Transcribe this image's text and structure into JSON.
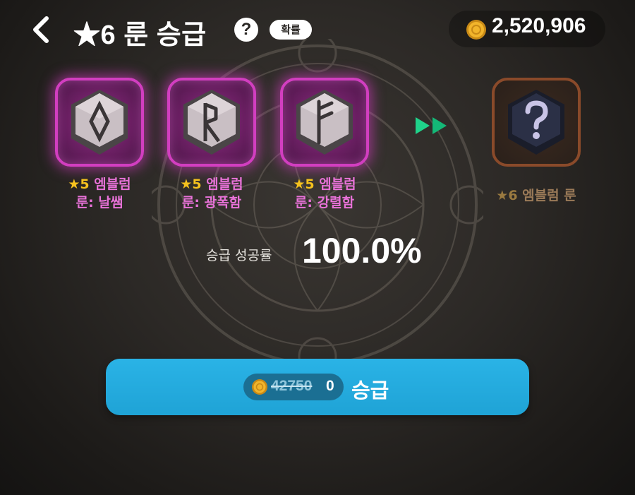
{
  "header": {
    "back_icon": "chevron-left-icon",
    "title": "★6 룬 승급",
    "help_label": "?",
    "probability_label": "확률",
    "gold_amount": "2,520,906",
    "gold_icon": "gold-coin-icon"
  },
  "materials": [
    {
      "line1_star": "★5",
      "line1_text": "엠블럼",
      "line2": "룬: 날쌤",
      "rune_icon": "diamond-rune-icon"
    },
    {
      "line1_star": "★5",
      "line1_text": "엠블럼",
      "line2": "룬: 광폭함",
      "rune_icon": "r-rune-icon"
    },
    {
      "line1_star": "★5",
      "line1_text": "엠블럼",
      "line2": "룬: 강렬함",
      "rune_icon": "f-rune-icon"
    }
  ],
  "result": {
    "star": "★6",
    "text": "엠블럼 룬",
    "icon": "question-mark-rune-icon"
  },
  "success_rate": {
    "label": "승급 성공률",
    "value": "100.0%"
  },
  "upgrade_button": {
    "original_cost": "42750",
    "discounted_cost": "0",
    "label": "승급"
  },
  "colors": {
    "accent_blue": "#1fa3d6",
    "rune_frame_pink": "#d23ec0",
    "result_frame_brown": "#8a4a2a",
    "star_gold": "#f5c21e",
    "arrow_green": "#1fd28a"
  }
}
